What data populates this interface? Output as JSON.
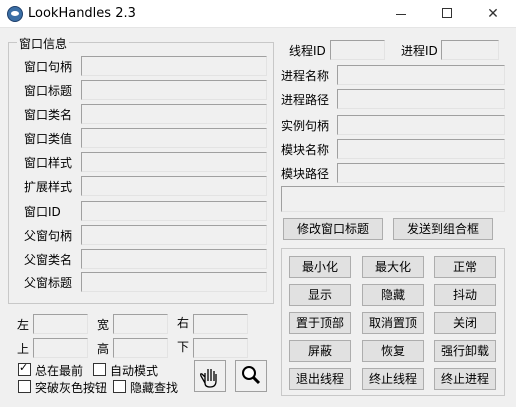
{
  "window": {
    "title": "LookHandles 2.3",
    "minimize": "",
    "maximize": "",
    "close": "✕"
  },
  "window_info": {
    "title": "窗口信息",
    "fields": [
      "窗口句柄",
      "窗口标题",
      "窗口类名",
      "窗口类值",
      "窗口样式",
      "扩展样式",
      "窗口ID",
      "父窗句柄",
      "父窗类名",
      "父窗标题"
    ]
  },
  "process": {
    "thread_id": "线程ID",
    "process_id": "进程ID",
    "name": "进程名称",
    "path": "进程路径",
    "instance": "实例句柄",
    "module_name": "模块名称",
    "module_path": "模块路径"
  },
  "actions": {
    "modify_title": "修改窗口标题",
    "send_to_combo": "发送到组合框"
  },
  "buttons": [
    [
      "最小化",
      "最大化",
      "正常"
    ],
    [
      "显示",
      "隐藏",
      "抖动"
    ],
    [
      "置于顶部",
      "取消置顶",
      "关闭"
    ],
    [
      "屏蔽",
      "恢复",
      "强行卸载"
    ],
    [
      "退出线程",
      "终止线程",
      "终止进程"
    ]
  ],
  "position": {
    "left": "左",
    "width": "宽",
    "right": "右",
    "top": "上",
    "height": "高",
    "bottom": "下"
  },
  "options": {
    "always_on_top": "总在最前",
    "auto_mode": "自动模式",
    "break_gray": "突破灰色按钮",
    "hidden_search": "隐藏查找",
    "always_on_top_checked": true
  },
  "tools": {
    "hand": "hand-icon",
    "magnifier": "magnifier-icon"
  }
}
